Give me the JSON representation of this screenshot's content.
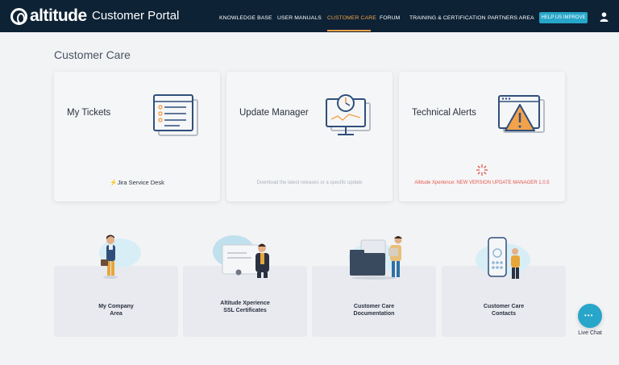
{
  "header": {
    "logo_text": "altitude",
    "portal_title": "Customer Portal",
    "nav": [
      {
        "label": "KNOWLEDGE BASE"
      },
      {
        "label": "USER MANUALS"
      },
      {
        "label": "CUSTOMER CARE",
        "active": true
      },
      {
        "label": "FORUM"
      },
      {
        "label": "TRAINING & CERTIFICATION"
      },
      {
        "label": "PARTNERS AREA"
      }
    ],
    "improve_label": "HELP US IMPROVE"
  },
  "page": {
    "title": "Customer Care"
  },
  "cards": [
    {
      "title": "My Tickets",
      "footer": "Jira Service Desk",
      "icon": "ticket-list-icon"
    },
    {
      "title": "Update Manager",
      "footer": "Download the latest releases or a specific update",
      "icon": "update-monitor-icon"
    },
    {
      "title": "Technical Alerts",
      "footer": "Altitude Xperience: NEW VERSION UPDATE MANAGER 1.0.5",
      "icon": "alert-window-icon"
    }
  ],
  "tiles": [
    {
      "line1": "My Company",
      "line2": "Area"
    },
    {
      "line1": "Altitude Xperience",
      "line2": "SSL Certificates"
    },
    {
      "line1": "Customer Care",
      "line2": "Documentation"
    },
    {
      "line1": "Customer Care",
      "line2": "Contacts"
    }
  ],
  "chat": {
    "label": "Live Chat"
  },
  "colors": {
    "header_bg": "#0d2235",
    "accent_orange": "#f2a24a",
    "accent_teal": "#27a6c9",
    "alert_red": "#e2574c"
  }
}
